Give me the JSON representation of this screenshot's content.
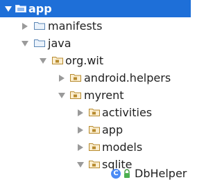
{
  "tree": {
    "items": [
      {
        "label": "app",
        "expanded": true,
        "selected": true
      },
      {
        "label": "manifests",
        "expanded": false
      },
      {
        "label": "java",
        "expanded": true
      },
      {
        "label": "org.wit",
        "expanded": true
      },
      {
        "label": "android.helpers",
        "expanded": false
      },
      {
        "label": "myrent",
        "expanded": true
      },
      {
        "label": "activities",
        "expanded": false
      },
      {
        "label": "app",
        "expanded": false
      },
      {
        "label": "models",
        "expanded": false
      },
      {
        "label": "sqlite",
        "expanded": true
      },
      {
        "label": "DbHelper",
        "class_icon_letter": "C"
      }
    ]
  }
}
